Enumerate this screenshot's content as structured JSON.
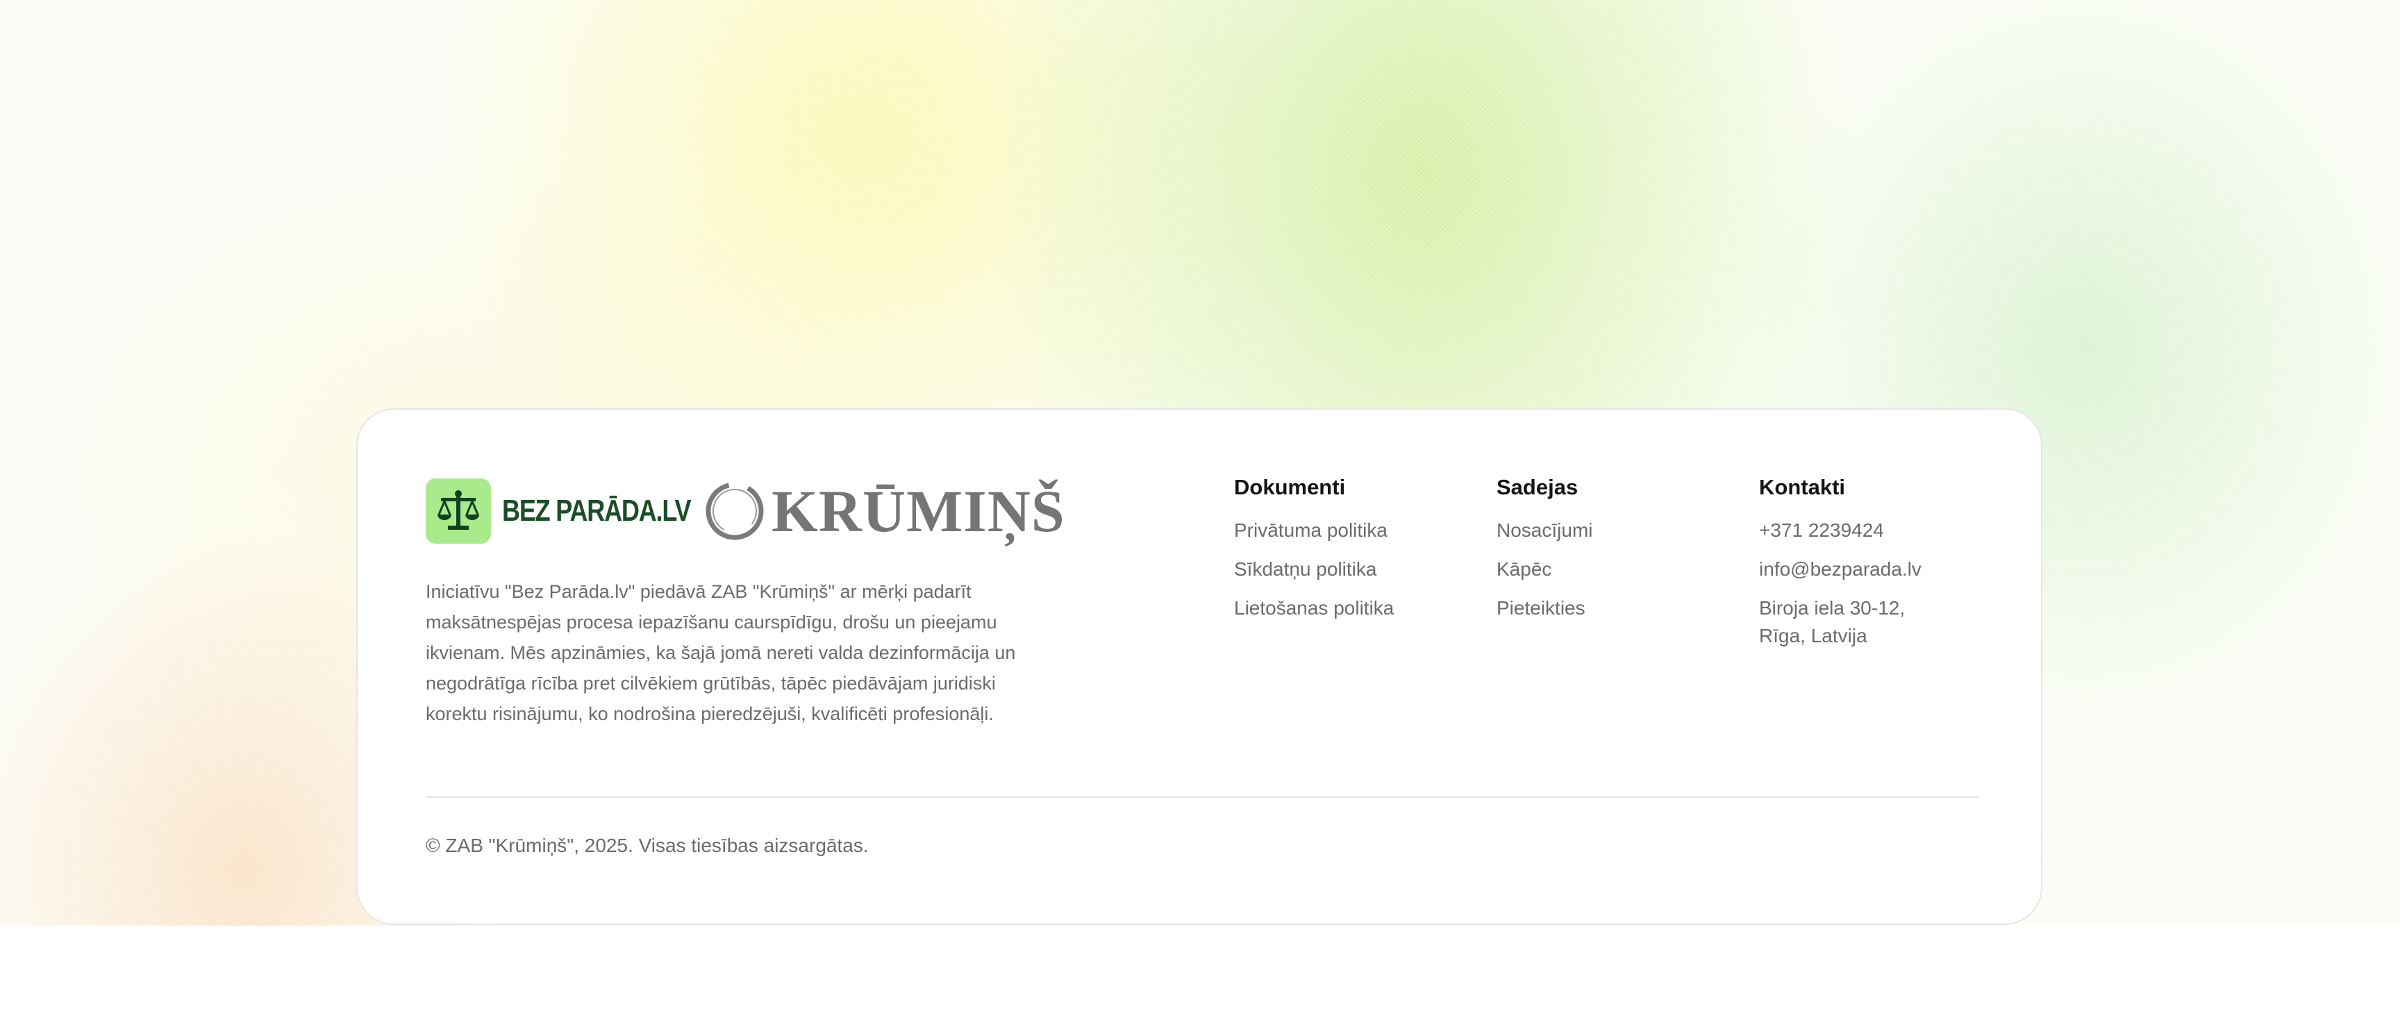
{
  "brand": {
    "bezparada_logo_text": "BEZ PARĀDA.LV",
    "krumins_logo_text": "KRŪMIŅŠ",
    "badge_color": "#a8ea8c",
    "logo_dark_green": "#1b4d27"
  },
  "about": {
    "text": "Iniciatīvu \"Bez Parāda.lv\" piedāvā ZAB \"Krūmiņš\" ar mērķi padarīt maksātnespējas procesa iepazīšanu caurspīdīgu, drošu un pieejamu ikvienam. Mēs apzināmies, ka šajā jomā nereti valda dezinformācija un negodrātīga rīcība pret cilvēkiem grūtībās, tāpēc piedāvājam juridiski korektu risinājumu, ko nodrošina pieredzējuši, kvalificēti profesionāļi."
  },
  "documents": {
    "heading": "Dokumenti",
    "links": [
      "Privātuma politika",
      "Sīkdatņu politika",
      "Lietošanas politika"
    ]
  },
  "sadejas": {
    "heading": "Sadejas",
    "links": [
      "Nosacījumi",
      "Kāpēc",
      "Pieteikties"
    ]
  },
  "contacts": {
    "heading": "Kontakti",
    "phone": "+371 2239424",
    "email": "info@bezparada.lv",
    "address_line1": "Biroja iela 30-12,",
    "address_line2": "Rīga, Latvija"
  },
  "footer": {
    "copyright": "© ZAB \"Krūmiņš\", 2025. Visas tiesības aizsargātas."
  }
}
